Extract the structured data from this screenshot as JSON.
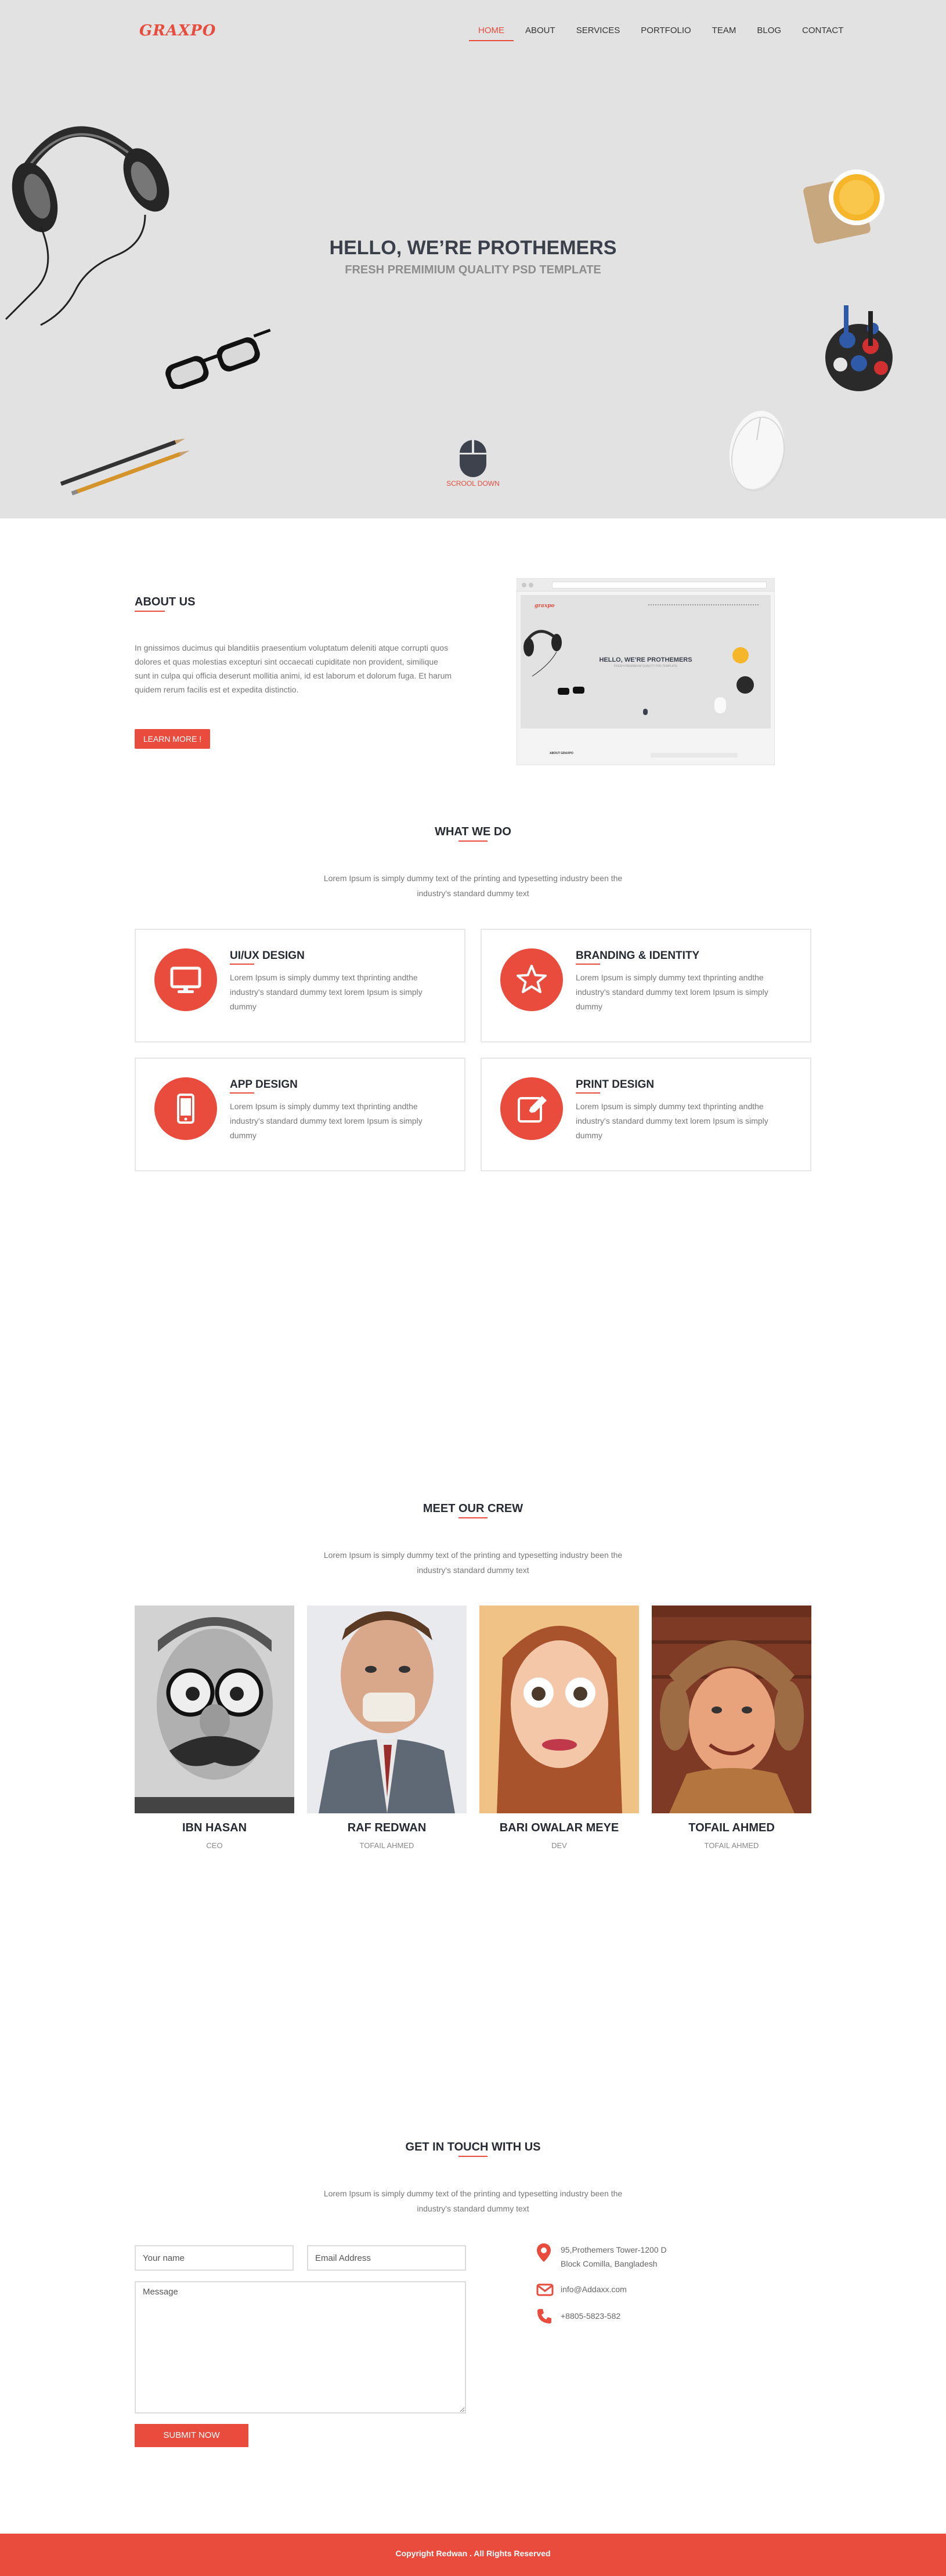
{
  "brand": {
    "logo": "GRAXPO",
    "accent": "#e94c3d"
  },
  "nav": {
    "items": [
      {
        "label": "HOME",
        "active": true
      },
      {
        "label": "ABOUT",
        "active": false
      },
      {
        "label": "SERVICES",
        "active": false
      },
      {
        "label": "PORTFOLIO",
        "active": false
      },
      {
        "label": "TEAM",
        "active": false
      },
      {
        "label": "BLOG",
        "active": false
      },
      {
        "label": "CONTACT",
        "active": false
      }
    ]
  },
  "hero": {
    "title": "HELLO, WE’RE PROTHEMERS",
    "subtitle": "FRESH PREMIMIUM QUALITY PSD TEMPLATE",
    "scroll_label": "SCROOL DOWN",
    "bg_color": "#e3e2e2"
  },
  "about": {
    "title": "ABOUT US",
    "text": "In gnissimos ducimus qui blanditiis praesentium voluptatum deleniti atque corrupti quos dolores et quas molestias excepturi sint occaecati cupiditate non provident, similique sunt in culpa qui officia deserunt mollitia animi, id est laborum et dolorum fuga. Et harum quidem rerum facilis est et expedita distinctio.",
    "button": "LEARN MORE !",
    "preview": {
      "logo": "graxpo",
      "title": "HELLO, WE’RE PROTHEMERS",
      "subtitle": "FRESH PREMIMIUM QUALITY PSD TEMPLATE",
      "section": "ABOUT GRAXPO"
    }
  },
  "services": {
    "title": "WHAT WE DO",
    "desc": "Lorem Ipsum is simply dummy text of the printing and typesetting industry been the industry's standard dummy text",
    "items": [
      {
        "title": "UI/UX DESIGN",
        "text": "Lorem Ipsum is simply dummy text thprinting andthe industry's standard dummy text lorem Ipsum is simply dummy",
        "icon": "monitor-icon"
      },
      {
        "title": "BRANDING & IDENTITY",
        "text": "Lorem Ipsum is simply dummy text thprinting andthe industry's standard dummy text lorem Ipsum is simply dummy",
        "icon": "star-icon"
      },
      {
        "title": "APP DESIGN",
        "text": "Lorem Ipsum is simply dummy text thprinting andthe industry's standard dummy text lorem Ipsum is simply dummy",
        "icon": "mobile-icon"
      },
      {
        "title": "PRINT DESIGN",
        "text": "Lorem Ipsum is simply dummy text thprinting andthe industry's standard dummy text lorem Ipsum is simply dummy",
        "icon": "edit-icon"
      }
    ]
  },
  "team": {
    "title": "MEET OUR CREW",
    "desc": "Lorem Ipsum is simply dummy text of the printing and typesetting industry been the industry's standard dummy text",
    "members": [
      {
        "name": "IBN HASAN",
        "role": "CEO"
      },
      {
        "name": "RAF REDWAN",
        "role": "TOFAIL AHMED"
      },
      {
        "name": "BARI OWALAR MEYE",
        "role": "DEV"
      },
      {
        "name": "TOFAIL AHMED",
        "role": "TOFAIL AHMED"
      }
    ]
  },
  "contact": {
    "title": "GET IN TOUCH WITH US",
    "desc": "Lorem Ipsum is simply dummy text of the printing and typesetting industry been the industry's standard dummy text",
    "name_placeholder": "Your name",
    "email_placeholder": "Email Address",
    "message_placeholder": "Message",
    "submit": "SUBMIT NOW",
    "address_line1": "95,Prothemers Tower-1200 D",
    "address_line2": "Block Comilla, Bangladesh",
    "email": "info@Addaxx.com",
    "phone": "+8805-5823-582"
  },
  "footer": {
    "text": "Copyright Redwan . All Rights Reserved"
  }
}
